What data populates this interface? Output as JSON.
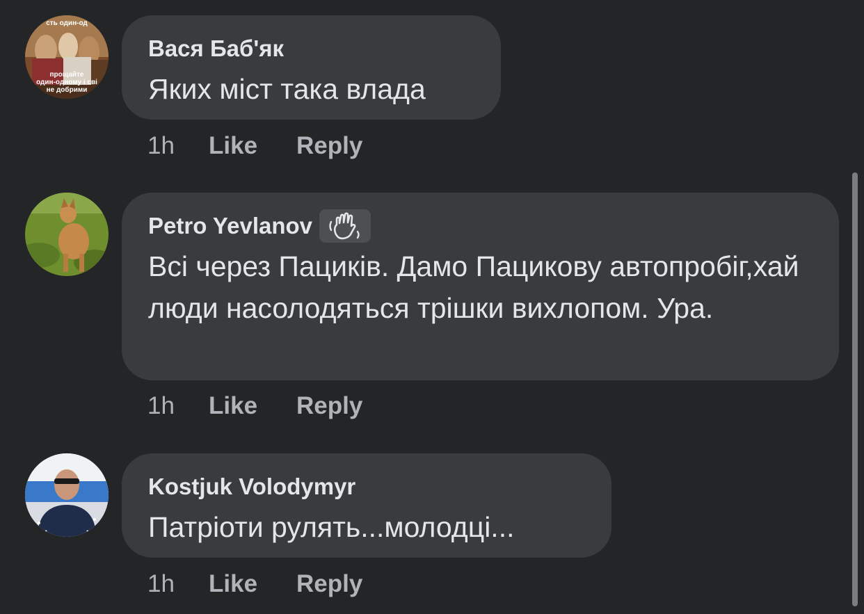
{
  "comments": [
    {
      "author": "Вася Баб'як",
      "text": "Яких міст така влада",
      "time": "1h",
      "like": "Like",
      "reply": "Reply",
      "avatar_text": [
        "сть один-од",
        "прощайте",
        "один-одному і сві",
        "не добрими"
      ]
    },
    {
      "author": "Petro Yevlanov",
      "badge_icon": "waving-hand-icon",
      "text": "Всі через Пациків. Дамо Пацикову автопробіг,хай люди насолодяться трішки вихлопом. Ура.",
      "time": "1h",
      "like": "Like",
      "reply": "Reply"
    },
    {
      "author": "Kostjuk Volodymyr",
      "text": "Патріоти рулять...молодці...",
      "time": "1h",
      "like": "Like",
      "reply": "Reply"
    }
  ],
  "colors": {
    "background": "#242526",
    "bubble": "#3a3b3c",
    "primary_text": "#e4e6eb",
    "secondary_text": "#b0b3b8"
  }
}
